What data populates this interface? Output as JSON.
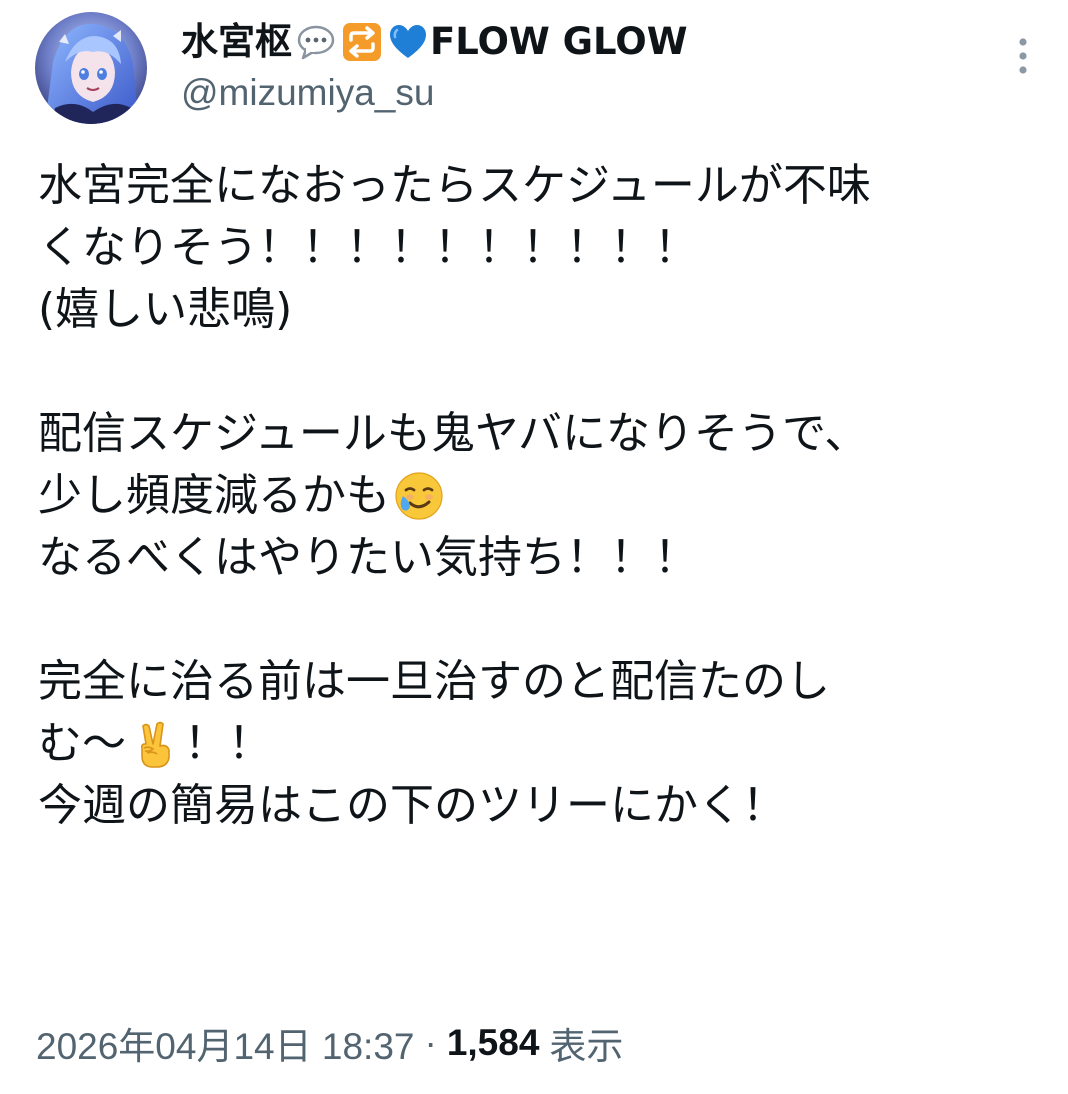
{
  "author": {
    "display_name": "水宮枢",
    "display_name_suffix": "FLOW GLOW",
    "name_emojis": [
      "speech-bubble-icon",
      "repeat-arrows-icon",
      "blue-heart-icon"
    ],
    "handle": "@mizumiya_su",
    "avatar_icon": "avatar-anime-character"
  },
  "tweet": {
    "lines": [
      "水宮完全になおったらスケジュールが不味",
      "くなりそう！！！！！！！！！！",
      "(嬉しい悲鳴)",
      "",
      "配信スケジュールも鬼ヤバになりそうで、",
      "少し頻度減るかも",
      "なるべくはやりたい気持ち！！！",
      "",
      "完全に治る前は一旦治すのと配信たのし",
      "む〜",
      "今週の簡易はこの下のツリーにかく！"
    ],
    "line6_emoji": "smiling-face-with-tear-icon",
    "line10_emoji": "victory-hand-icon",
    "line10_tail": "！！"
  },
  "meta": {
    "timestamp": "2026年04月14日 18:37",
    "separator": "·",
    "view_count": "1,584",
    "view_label": "表示"
  },
  "colors": {
    "text_primary": "#0f1419",
    "text_secondary": "#536471",
    "background": "#ffffff"
  }
}
